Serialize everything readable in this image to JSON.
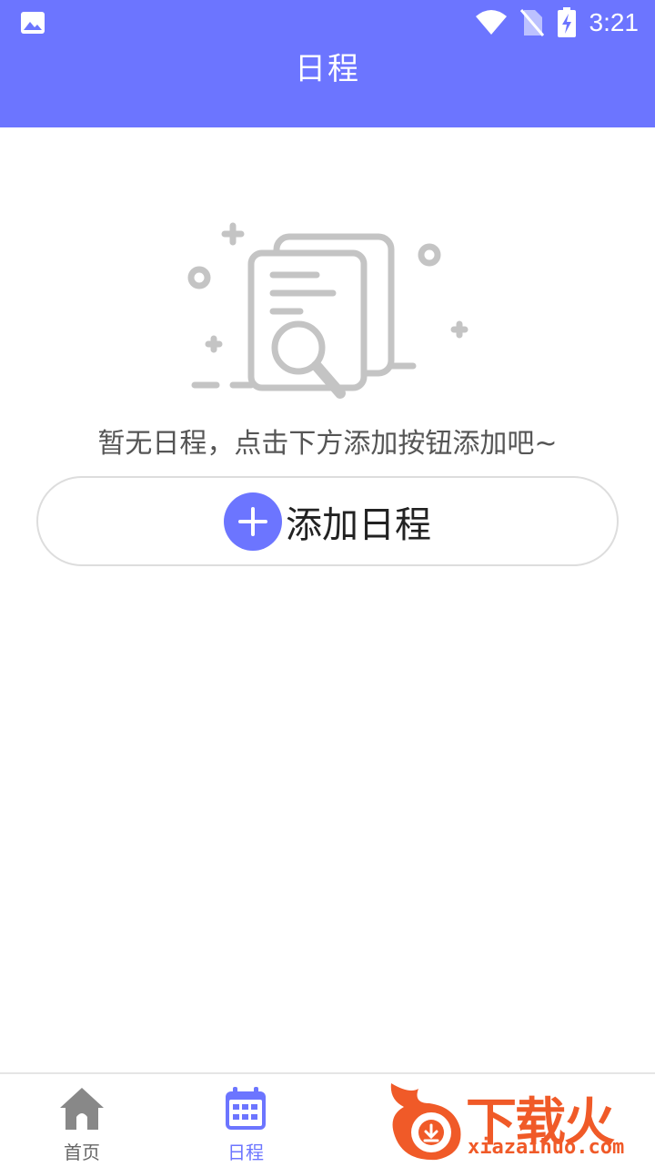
{
  "status_bar": {
    "time": "3:21",
    "icons": [
      "image-icon",
      "wifi-icon",
      "no-sim-icon",
      "battery-charging-icon"
    ]
  },
  "header": {
    "title": "日程"
  },
  "empty_state": {
    "illustration": "document-search-icon",
    "message": "暂无日程，点击下方添加按钮添加吧~"
  },
  "add_button": {
    "label": "添加日程",
    "icon": "plus-icon"
  },
  "tabbar": {
    "tabs": [
      {
        "label": "首页",
        "icon": "home-icon",
        "active": false
      },
      {
        "label": "日程",
        "icon": "calendar-icon",
        "active": true
      }
    ]
  },
  "watermark": {
    "brand": "下载火",
    "domain": "xiazaihuo.com"
  },
  "colors": {
    "primary": "#6c75ff",
    "inactive": "#888888"
  }
}
